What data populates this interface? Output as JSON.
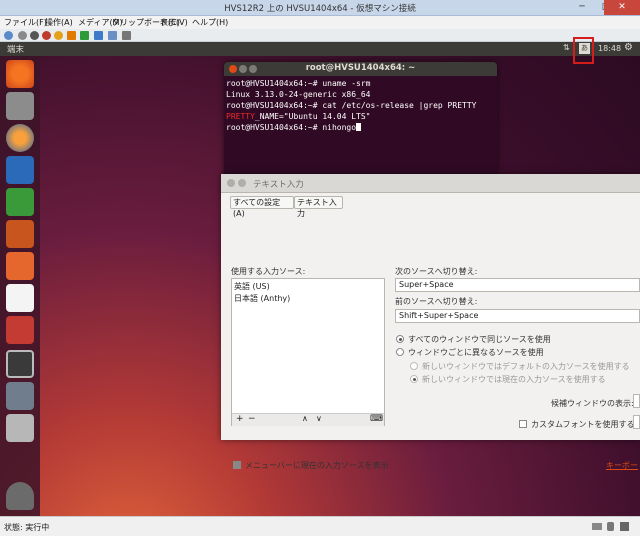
{
  "host": {
    "title": "HVS12R2 上の HVSU1404x64 - 仮想マシン接続",
    "min": "─",
    "max": "□",
    "close": "✕",
    "menu": [
      "ファイル(F)",
      "操作(A)",
      "メディア(M)",
      "クリップボード(C)",
      "表示(V)",
      "ヘルプ(H)"
    ],
    "status": "状態: 実行中"
  },
  "guest": {
    "topbar": {
      "app": "端末",
      "net": "⇅",
      "kbd": "あ",
      "clock": "18:48",
      "gear": "⚙"
    },
    "terminal": {
      "title": "root@HVSU1404x64: ~",
      "lines": [
        "root@HVSU1404x64:~# uname -srm",
        "Linux 3.13.0-24-generic x86_64",
        "root@HVSU1404x64:~# cat /etc/os-release |grep PRETTY",
        "_NAME=\"Ubuntu 14.04 LTS\"",
        "root@HVSU1404x64:~# nihongo"
      ],
      "highlight": "PRETTY"
    },
    "dialog": {
      "title": "テキスト入力",
      "crumbs": [
        "すべての設定(A)",
        "テキスト入力"
      ],
      "sources_label": "使用する入力ソース:",
      "sources": [
        "英語 (US)",
        "日本語 (Anthy)"
      ],
      "list_buttons": {
        "add": "+",
        "remove": "−",
        "up": "∧",
        "down": "∨",
        "kbd": "⌨"
      },
      "next_label": "次のソースへ切り替え:",
      "next_value": "Super+Space",
      "prev_label": "前のソースへ切り替え:",
      "prev_value": "Shift+Super+Space",
      "radio_same": "すべてのウィンドウで同じソースを使用",
      "radio_diff": "ウィンドウごとに異なるソースを使用",
      "sub_default": "新しいウィンドウではデフォルトの入力ソースを使用する",
      "sub_current": "新しいウィンドウでは現在の入力ソースを使用する",
      "candidate_label": "候補ウィンドウの表示:",
      "custom_font": "カスタムフォントを使用する:",
      "menubar_check": "メニューバーに現在の入力ソースを表示",
      "keyboard_link": "キーボー"
    }
  },
  "colors": {
    "accent": "#dd4814",
    "terminal_bg": "#300a24",
    "highlight": "#d51d1d"
  }
}
